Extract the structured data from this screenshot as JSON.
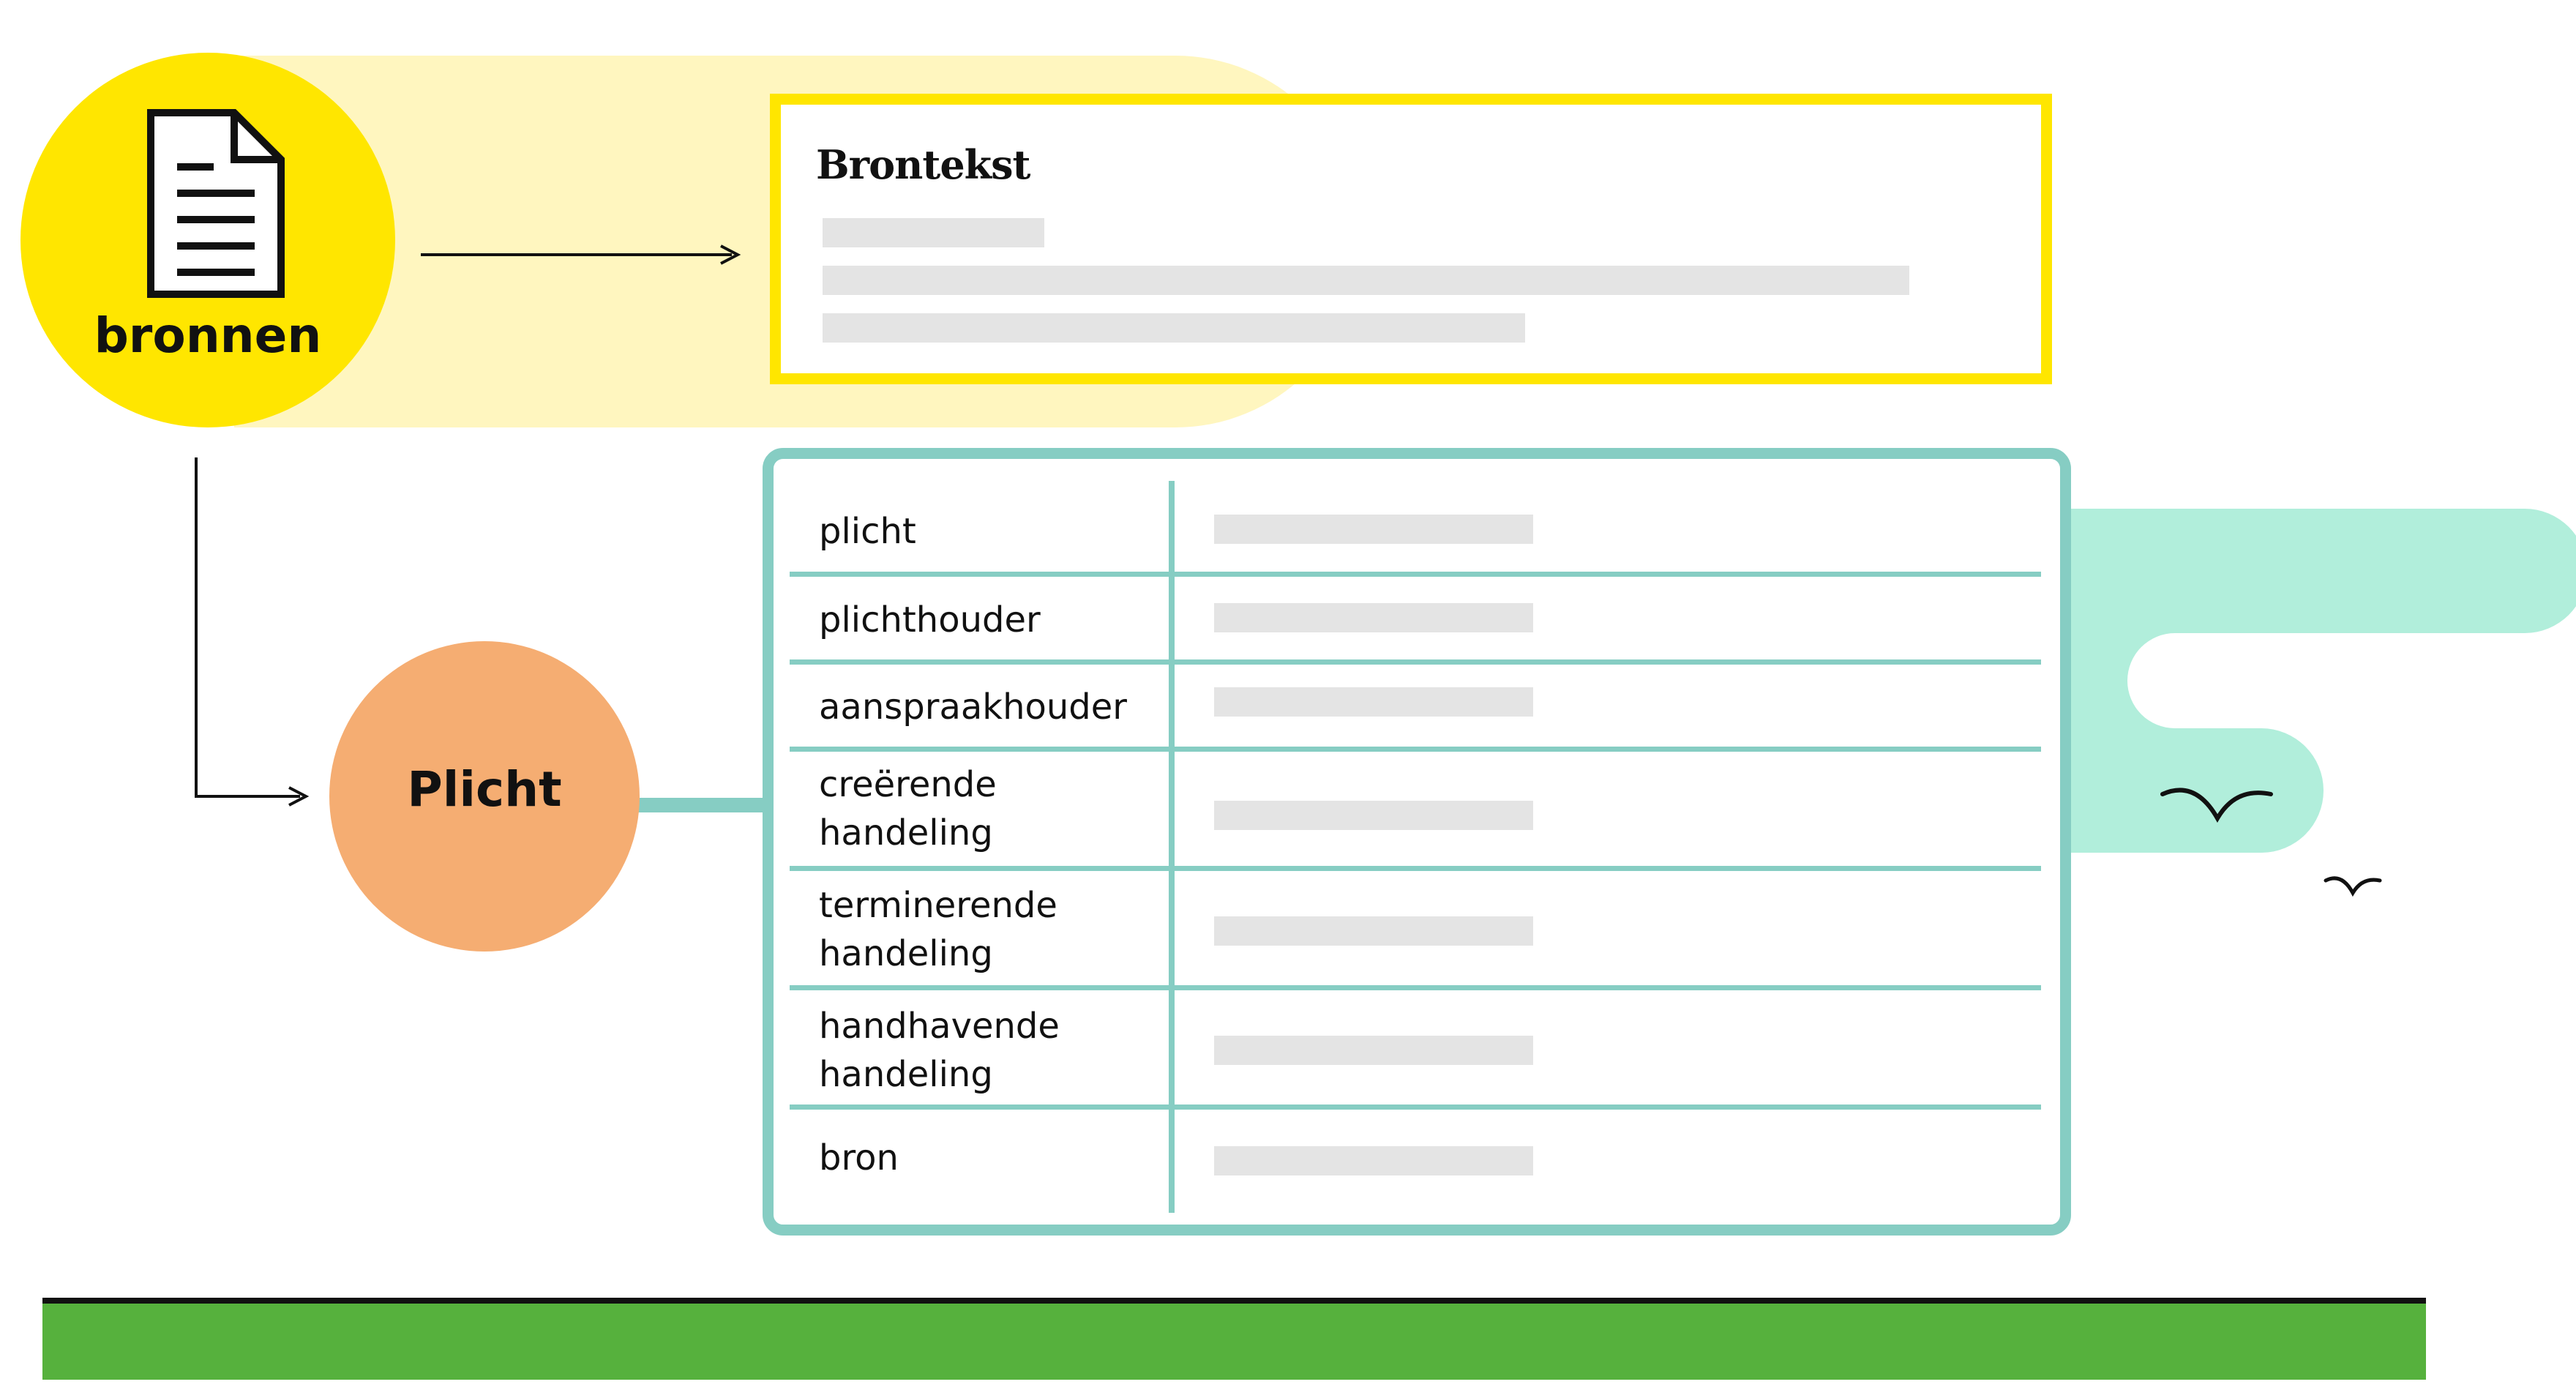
{
  "colors": {
    "source_yellow": "#ffe600",
    "band_yellow": "#fff6bf",
    "teal": "#86cdc3",
    "teal_cloud": "#b1eedb",
    "orange": "#f5ad72",
    "green": "#56b13d",
    "placeholder_gray": "#e4e4e4"
  },
  "source": {
    "label": "bronnen",
    "icon": "document-icon"
  },
  "source_card": {
    "title": "Brontekst"
  },
  "plicht": {
    "label": "Plicht"
  },
  "plicht_table": {
    "rows": [
      {
        "label": "plicht"
      },
      {
        "label": "plichthouder"
      },
      {
        "label": "aanspraakhouder"
      },
      {
        "label": "creërende handeling"
      },
      {
        "label": "terminerende handeling"
      },
      {
        "label": "handhavende handeling"
      },
      {
        "label": "bron"
      }
    ]
  },
  "decorations": {
    "birds": [
      "bird-icon",
      "bird-icon"
    ],
    "ground": "grass-bar"
  }
}
